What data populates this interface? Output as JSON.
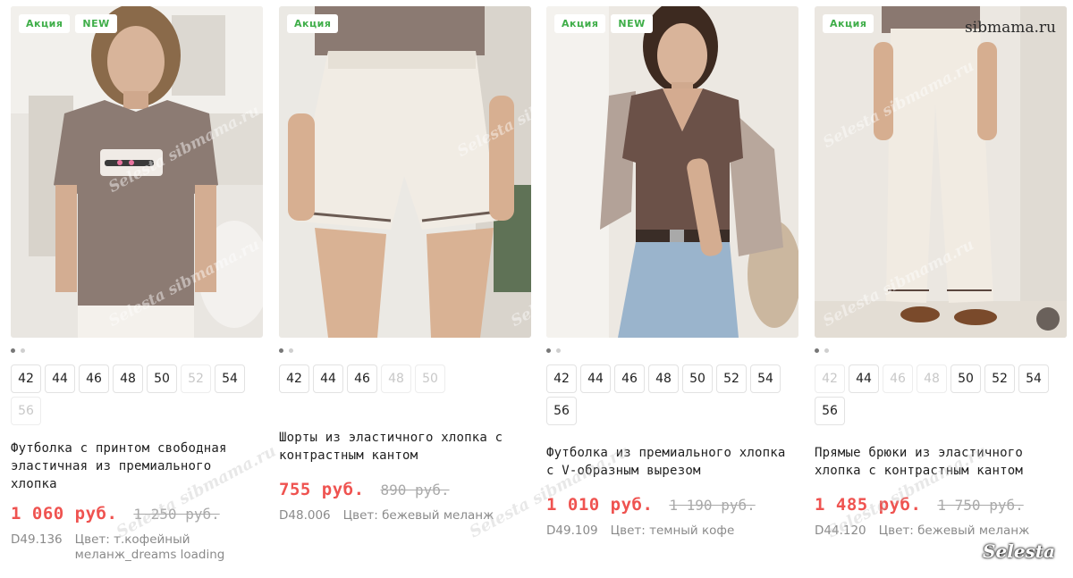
{
  "watermarks": {
    "site": "sibmama.ru",
    "brand_diag": "Selesta sibmama.ru",
    "corner": "Selesta"
  },
  "colors": {
    "badge_text": "#3fae49",
    "price": "#ef5350",
    "old_price": "#a9a9a9"
  },
  "products": [
    {
      "badges": [
        "Акция",
        "NEW"
      ],
      "dots_active": 0,
      "sizes": [
        {
          "label": "42",
          "available": true
        },
        {
          "label": "44",
          "available": true
        },
        {
          "label": "46",
          "available": true
        },
        {
          "label": "48",
          "available": true
        },
        {
          "label": "50",
          "available": true
        },
        {
          "label": "52",
          "available": false
        },
        {
          "label": "54",
          "available": true
        },
        {
          "label": "56",
          "available": false
        }
      ],
      "title": "Футболка с принтом свободная эластичная из премиального хлопка",
      "price": "1 060 руб.",
      "old_price": "1 250 руб.",
      "article": "D49.136",
      "color": "Цвет: т.кофейный меланж_dreams loading"
    },
    {
      "badges": [
        "Акция"
      ],
      "dots_active": 0,
      "sizes": [
        {
          "label": "42",
          "available": true
        },
        {
          "label": "44",
          "available": true
        },
        {
          "label": "46",
          "available": true
        },
        {
          "label": "48",
          "available": false
        },
        {
          "label": "50",
          "available": false
        }
      ],
      "title": "Шорты из эластичного хлопка с контрастным кантом",
      "price": "755 руб.",
      "old_price": "890 руб.",
      "article": "D48.006",
      "color": "Цвет: бежевый меланж"
    },
    {
      "badges": [
        "Акция",
        "NEW"
      ],
      "dots_active": 0,
      "sizes": [
        {
          "label": "42",
          "available": true
        },
        {
          "label": "44",
          "available": true
        },
        {
          "label": "46",
          "available": true
        },
        {
          "label": "48",
          "available": true
        },
        {
          "label": "50",
          "available": true
        },
        {
          "label": "52",
          "available": true
        },
        {
          "label": "54",
          "available": true
        },
        {
          "label": "56",
          "available": true
        }
      ],
      "title": "Футболка из премиального хлопка с V-образным вырезом",
      "price": "1 010 руб.",
      "old_price": "1 190 руб.",
      "article": "D49.109",
      "color": "Цвет: темный кофе"
    },
    {
      "badges": [
        "Акция"
      ],
      "dots_active": 0,
      "sizes": [
        {
          "label": "42",
          "available": false
        },
        {
          "label": "44",
          "available": true
        },
        {
          "label": "46",
          "available": false
        },
        {
          "label": "48",
          "available": false
        },
        {
          "label": "50",
          "available": true
        },
        {
          "label": "52",
          "available": true
        },
        {
          "label": "54",
          "available": true
        },
        {
          "label": "56",
          "available": true
        }
      ],
      "title": "Прямые брюки из эластичного хлопка с контрастным кантом",
      "price": "1 485 руб.",
      "old_price": "1 750 руб.",
      "article": "D44.120",
      "color": "Цвет: бежевый меланж"
    }
  ]
}
